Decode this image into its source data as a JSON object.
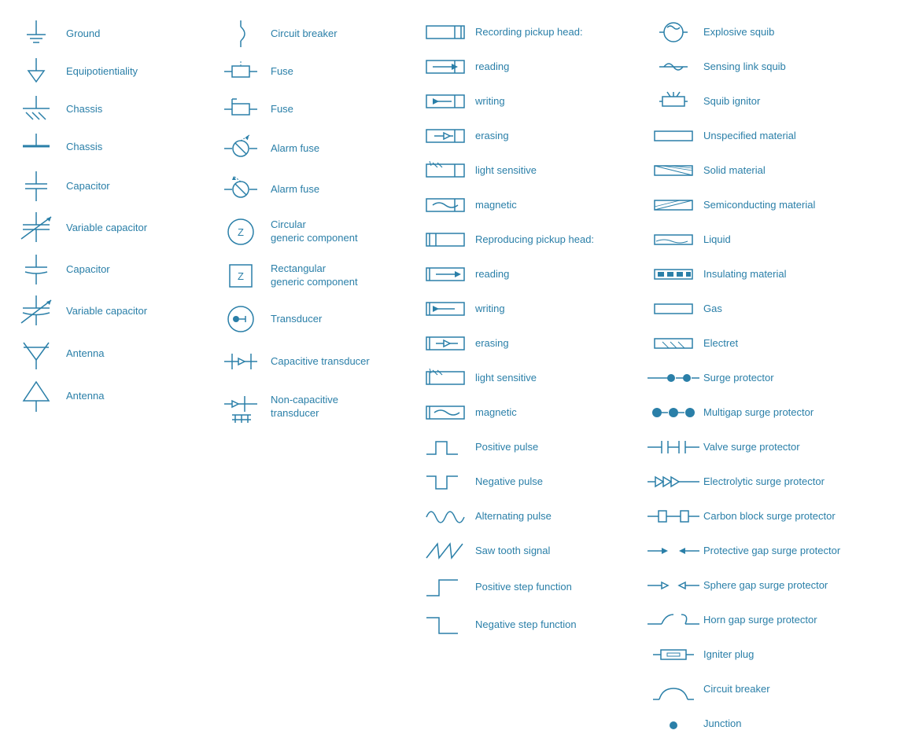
{
  "col1": [
    {
      "id": "ground",
      "label": "Ground"
    },
    {
      "id": "equipotientiality",
      "label": "Equipotientiality"
    },
    {
      "id": "chassis1",
      "label": "Chassis"
    },
    {
      "id": "chassis2",
      "label": "Chassis"
    },
    {
      "id": "capacitor1",
      "label": "Capacitor"
    },
    {
      "id": "variable-capacitor1",
      "label": "Variable capacitor"
    },
    {
      "id": "capacitor2",
      "label": "Capacitor"
    },
    {
      "id": "variable-capacitor2",
      "label": "Variable capacitor"
    },
    {
      "id": "antenna1",
      "label": "Antenna"
    },
    {
      "id": "antenna2",
      "label": "Antenna"
    }
  ],
  "col2": [
    {
      "id": "circuit-breaker",
      "label": "Circuit breaker"
    },
    {
      "id": "fuse1",
      "label": "Fuse"
    },
    {
      "id": "fuse2",
      "label": "Fuse"
    },
    {
      "id": "alarm-fuse1",
      "label": "Alarm fuse"
    },
    {
      "id": "alarm-fuse2",
      "label": "Alarm fuse"
    },
    {
      "id": "circular-generic",
      "label": "Circular\ngeneric component",
      "tall": true
    },
    {
      "id": "rectangular-generic",
      "label": "Rectangular\ngeneric component",
      "tall": true
    },
    {
      "id": "transducer",
      "label": "Transducer"
    },
    {
      "id": "capacitive-transducer",
      "label": "Capacitive transducer"
    },
    {
      "id": "non-capacitive-transducer",
      "label": "Non-capacitive\ntransducer",
      "tall": true
    }
  ],
  "col3": [
    {
      "id": "recording-pickup-head",
      "label": "Recording pickup head:"
    },
    {
      "id": "reading1",
      "label": "reading"
    },
    {
      "id": "writing1",
      "label": "writing"
    },
    {
      "id": "erasing1",
      "label": "erasing"
    },
    {
      "id": "light-sensitive1",
      "label": "light sensitive"
    },
    {
      "id": "magnetic1",
      "label": "magnetic"
    },
    {
      "id": "reproducing-pickup-head",
      "label": "Reproducing pickup head:"
    },
    {
      "id": "reading2",
      "label": "reading"
    },
    {
      "id": "writing2",
      "label": "writing"
    },
    {
      "id": "erasing2",
      "label": "erasing"
    },
    {
      "id": "light-sensitive2",
      "label": "light sensitive"
    },
    {
      "id": "magnetic2",
      "label": "magnetic"
    },
    {
      "id": "positive-pulse",
      "label": "Positive pulse"
    },
    {
      "id": "negative-pulse",
      "label": "Negative pulse"
    },
    {
      "id": "alternating-pulse",
      "label": "Alternating pulse"
    },
    {
      "id": "saw-tooth",
      "label": "Saw tooth signal"
    },
    {
      "id": "positive-step",
      "label": "Positive step function"
    },
    {
      "id": "negative-step",
      "label": "Negative step function"
    }
  ],
  "col4": [
    {
      "id": "explosive-squib",
      "label": "Explosive squib"
    },
    {
      "id": "sensing-link-squib",
      "label": "Sensing link squib"
    },
    {
      "id": "squib-ignitor",
      "label": "Squib ignitor"
    },
    {
      "id": "unspecified-material",
      "label": "Unspecified material"
    },
    {
      "id": "solid-material",
      "label": "Solid material"
    },
    {
      "id": "semiconducting-material",
      "label": "Semiconducting material"
    },
    {
      "id": "liquid",
      "label": "Liquid"
    },
    {
      "id": "insulating-material",
      "label": "Insulating material"
    },
    {
      "id": "gas",
      "label": "Gas"
    },
    {
      "id": "electret",
      "label": "Electret"
    },
    {
      "id": "surge-protector",
      "label": "Surge protector"
    },
    {
      "id": "multigap-surge-protector",
      "label": "Multigap surge protector"
    },
    {
      "id": "valve-surge-protector",
      "label": "Valve surge protector"
    },
    {
      "id": "electrolytic-surge-protector",
      "label": "Electrolytic surge protector"
    },
    {
      "id": "carbon-block-surge-protector",
      "label": "Carbon block surge protector"
    },
    {
      "id": "protective-gap-surge-protector",
      "label": "Protective gap surge protector"
    },
    {
      "id": "sphere-gap-surge-protector",
      "label": "Sphere gap surge protector"
    },
    {
      "id": "horn-gap-surge-protector",
      "label": "Horn gap surge protector"
    },
    {
      "id": "igniter-plug",
      "label": "Igniter plug"
    },
    {
      "id": "circuit-breaker-col4",
      "label": "Circuit breaker"
    },
    {
      "id": "junction",
      "label": "Junction"
    }
  ]
}
